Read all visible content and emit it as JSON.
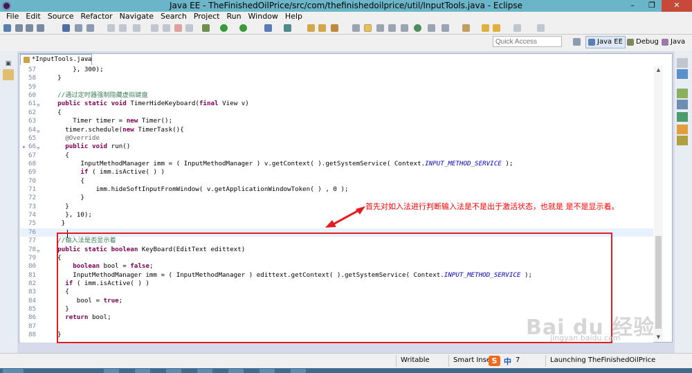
{
  "window": {
    "title": "Java EE - TheFinishedOilPrice/src/com/thefinishedoilprice/util/InputTools.java - Eclipse",
    "min": "–",
    "max": "❐",
    "close": "✕"
  },
  "menubar": {
    "items": [
      "File",
      "Edit",
      "Source",
      "Refactor",
      "Navigate",
      "Search",
      "Project",
      "Run",
      "Window",
      "Help"
    ]
  },
  "quick_access": {
    "placeholder": "Quick Access"
  },
  "perspectives": [
    {
      "label": "Java EE",
      "active": true
    },
    {
      "label": "Debug",
      "active": false
    },
    {
      "label": "Java",
      "active": false
    }
  ],
  "editor": {
    "tab_label": "*InputTools.java",
    "tab_close": "☒",
    "lines": [
      {
        "n": "57",
        "code": "        }, 300);"
      },
      {
        "n": "58",
        "code": "    }"
      },
      {
        "n": "59",
        "code": ""
      },
      {
        "n": "60",
        "code": "    //通过定时器强制隐藏虚拟键盘"
      },
      {
        "n": "61",
        "code": "    public static void TimerHideKeyboard(final View v)"
      },
      {
        "n": "62",
        "code": "    {"
      },
      {
        "n": "63",
        "code": "        Timer timer = new Timer();"
      },
      {
        "n": "64",
        "code": "      timer.schedule(new TimerTask(){"
      },
      {
        "n": "65",
        "code": "      @Override"
      },
      {
        "n": "66",
        "code": "      public void run()"
      },
      {
        "n": "67",
        "code": "      {"
      },
      {
        "n": "68",
        "code": "          InputMethodManager imm = ( InputMethodManager ) v.getContext( ).getSystemService( Context.INPUT_METHOD_SERVICE );"
      },
      {
        "n": "69",
        "code": "          if ( imm.isActive( ) )"
      },
      {
        "n": "70",
        "code": "          {"
      },
      {
        "n": "71",
        "code": "              imm.hideSoftInputFromWindow( v.getApplicationWindowToken( ) , 0 );"
      },
      {
        "n": "72",
        "code": "          }"
      },
      {
        "n": "73",
        "code": "      }"
      },
      {
        "n": "74",
        "code": "      }, 10);"
      },
      {
        "n": "75",
        "code": "     }"
      },
      {
        "n": "76",
        "code": ""
      },
      {
        "n": "77",
        "code": "    //输入法是否显示着"
      },
      {
        "n": "78",
        "code": "    public static boolean KeyBoard(EditText edittext)"
      },
      {
        "n": "79",
        "code": "    {"
      },
      {
        "n": "80",
        "code": "        boolean bool = false;"
      },
      {
        "n": "81",
        "code": "        InputMethodManager imm = ( InputMethodManager ) edittext.getContext( ).getSystemService( Context.INPUT_METHOD_SERVICE );"
      },
      {
        "n": "82",
        "code": "      if ( imm.isActive( ) )"
      },
      {
        "n": "83",
        "code": "      {"
      },
      {
        "n": "84",
        "code": "         bool = true;"
      },
      {
        "n": "85",
        "code": "      }"
      },
      {
        "n": "86",
        "code": "      return bool;"
      },
      {
        "n": "87",
        "code": ""
      },
      {
        "n": "88",
        "code": "    }"
      }
    ]
  },
  "annotation": {
    "text": "首先对如入法进行判断输入法是不是出于激活状态，也就是 是不是显示着。"
  },
  "statusbar": {
    "writable": "Writable",
    "insert_mode": "Smart Insert",
    "ime_s": "S",
    "ime_zh": "中",
    "ime_extra": "7",
    "progress": "Launching TheFinishedOilPrice"
  },
  "watermark": {
    "text": "Bai du 经验",
    "url": "jingyan.baidu.com"
  },
  "colors": {
    "title_bar": "#6bb5c8",
    "close": "#c7493a",
    "annotation": "#ff0000",
    "keyword": "#7f0055",
    "comment": "#3f7f5f",
    "field": "#0000c0"
  }
}
